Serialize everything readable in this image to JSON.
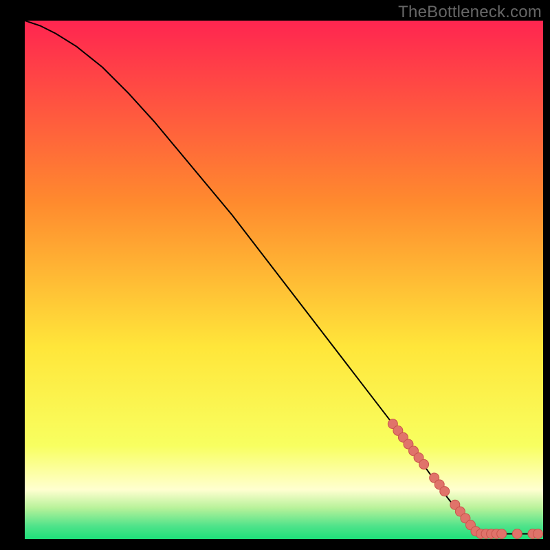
{
  "watermark": "TheBottleneck.com",
  "colors": {
    "gradient_top": "#ff2550",
    "gradient_mid1": "#ff8a2e",
    "gradient_mid2": "#ffe63a",
    "gradient_mid3": "#f8ff60",
    "gradient_bottom": "#1ee07a",
    "curve_stroke": "#000000",
    "marker_fill": "#e0736a",
    "marker_stroke": "#c9544c",
    "frame_bg": "#000000"
  },
  "chart_data": {
    "type": "line",
    "title": "",
    "xlabel": "",
    "ylabel": "",
    "xlim": [
      0,
      100
    ],
    "ylim": [
      0,
      100
    ],
    "series": [
      {
        "name": "curve",
        "x": [
          0,
          3,
          6,
          10,
          15,
          20,
          25,
          30,
          35,
          40,
          45,
          50,
          55,
          60,
          65,
          70,
          75,
          80,
          85,
          87,
          90,
          95,
          100
        ],
        "y": [
          100,
          99,
          97.5,
          95,
          91,
          86,
          80.5,
          74.5,
          68.5,
          62.5,
          56,
          49.5,
          43,
          36.5,
          30,
          23.5,
          17,
          10,
          3.5,
          1.5,
          1,
          1,
          1
        ]
      }
    ],
    "markers": {
      "name": "highlighted-points",
      "x": [
        71,
        72,
        73,
        74,
        75,
        76,
        77,
        79,
        80,
        81,
        83,
        84,
        85,
        86,
        87,
        88,
        89,
        90,
        91,
        92,
        95,
        98,
        99
      ],
      "y": [
        22.2,
        20.9,
        19.6,
        18.3,
        17.0,
        15.7,
        14.4,
        11.8,
        10.5,
        9.2,
        6.6,
        5.3,
        4.0,
        2.7,
        1.5,
        1.0,
        1.0,
        1.0,
        1.0,
        1.0,
        1.0,
        1.0,
        1.0
      ]
    }
  }
}
